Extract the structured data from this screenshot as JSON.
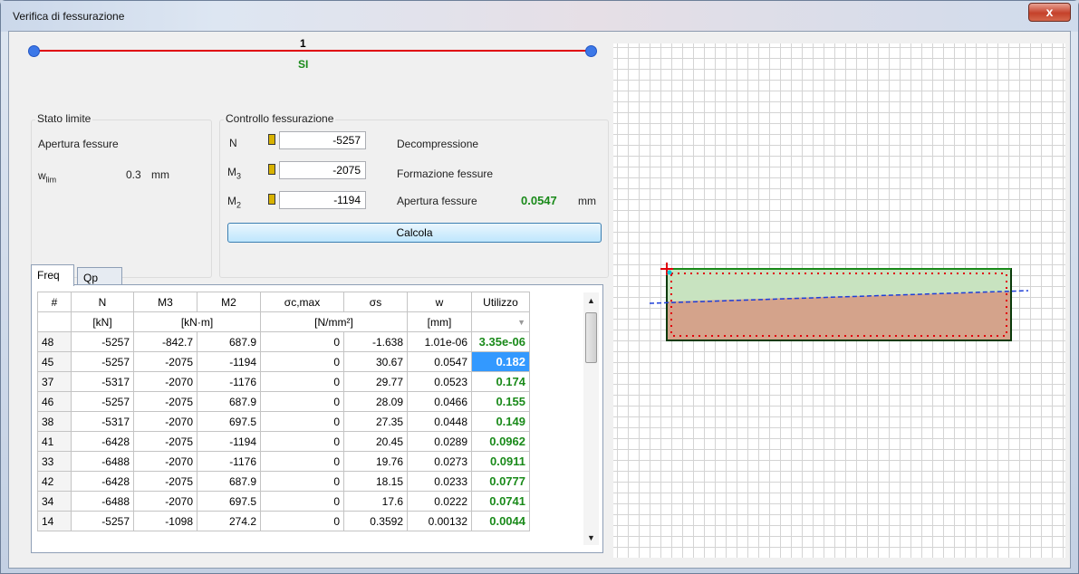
{
  "window": {
    "title": "Verifica di fessurazione",
    "close_label": "x"
  },
  "beam": {
    "number": "1",
    "state": "SI"
  },
  "stato_limite": {
    "title": "Stato limite",
    "type": "Apertura fessure",
    "wlim_symbol": "w",
    "wlim_sub": "lim",
    "wlim_value": "0.3",
    "wlim_unit": "mm"
  },
  "controllo": {
    "title": "Controllo fessurazione",
    "n_label": "N",
    "n_value": "-5257",
    "m3_label": "M",
    "m3_sub": "3",
    "m3_value": "-2075",
    "m2_label": "M",
    "m2_sub": "2",
    "m2_value": "-1194",
    "decompressione": "Decompressione",
    "formazione": "Formazione fessure",
    "apertura": "Apertura fessure",
    "apertura_value": "0.0547",
    "apertura_unit": "mm",
    "calcola_label": "Calcola"
  },
  "tabs": [
    "Freq",
    "Qp"
  ],
  "table": {
    "headers": [
      "#",
      "N",
      "M3",
      "M2",
      "σc,max",
      "σs",
      "w",
      "Utilizzo"
    ],
    "units": [
      "",
      "[kN]",
      "[kN·m]",
      "[N/mm²]",
      "[mm]"
    ],
    "rows": [
      [
        "48",
        "-5257",
        "-842.7",
        "687.9",
        "0",
        "-1.638",
        "1.01e-06",
        "3.35e-06"
      ],
      [
        "45",
        "-5257",
        "-2075",
        "-1194",
        "0",
        "30.67",
        "0.0547",
        "0.182"
      ],
      [
        "37",
        "-5317",
        "-2070",
        "-1176",
        "0",
        "29.77",
        "0.0523",
        "0.174"
      ],
      [
        "46",
        "-5257",
        "-2075",
        "687.9",
        "0",
        "28.09",
        "0.0466",
        "0.155"
      ],
      [
        "38",
        "-5317",
        "-2070",
        "697.5",
        "0",
        "27.35",
        "0.0448",
        "0.149"
      ],
      [
        "41",
        "-6428",
        "-2075",
        "-1194",
        "0",
        "20.45",
        "0.0289",
        "0.0962"
      ],
      [
        "33",
        "-6488",
        "-2070",
        "-1176",
        "0",
        "19.76",
        "0.0273",
        "0.0911"
      ],
      [
        "42",
        "-6428",
        "-2075",
        "687.9",
        "0",
        "18.15",
        "0.0233",
        "0.0777"
      ],
      [
        "34",
        "-6488",
        "-2070",
        "697.5",
        "0",
        "17.6",
        "0.0222",
        "0.0741"
      ],
      [
        "14",
        "-5257",
        "-1098",
        "274.2",
        "0",
        "0.3592",
        "0.00132",
        "0.0044"
      ]
    ],
    "selected_row": 1
  },
  "colors": {
    "beam_line": "#e0000a",
    "result_green": "#1a8a1a",
    "compression_zone": "#d4a38b",
    "tension_zone": "#c8e3c0",
    "neutral_axis": "#1e3fd8"
  }
}
